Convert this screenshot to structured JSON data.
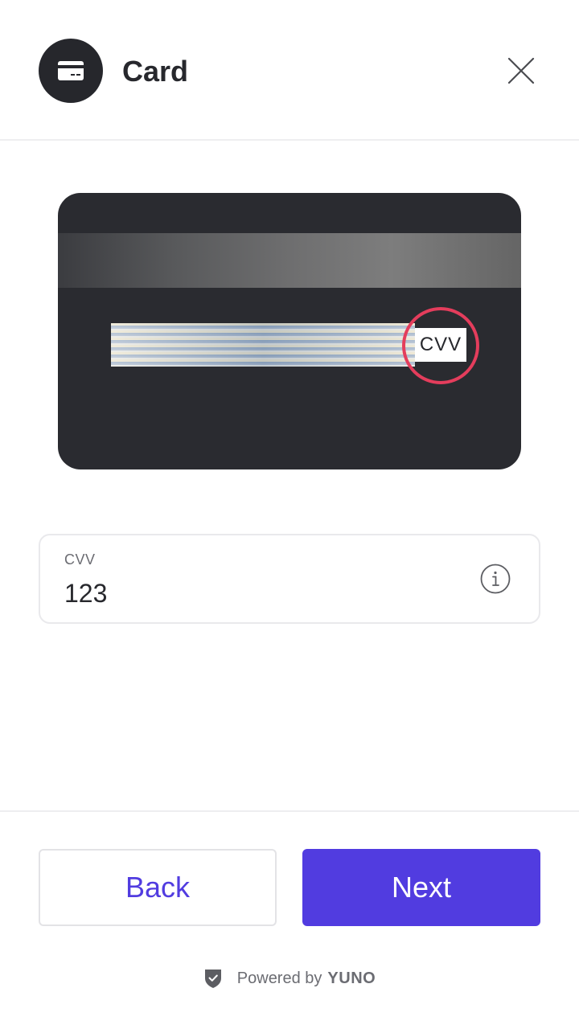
{
  "header": {
    "title": "Card",
    "icon": "credit-card-icon",
    "close_icon": "close-icon"
  },
  "card_illustration": {
    "cvv_marker_text": "CVV",
    "highlight_color": "#e43d5c",
    "card_color": "#2a2b30"
  },
  "cvv_field": {
    "label": "CVV",
    "value": "123",
    "info_icon": "info-icon"
  },
  "footer": {
    "back_label": "Back",
    "next_label": "Next",
    "powered_prefix": "Powered by",
    "powered_brand": "YUNO",
    "shield_icon": "shield-check-icon"
  },
  "colors": {
    "accent": "#513ce0",
    "text_dark": "#27282d",
    "text_muted": "#6b6c72"
  }
}
